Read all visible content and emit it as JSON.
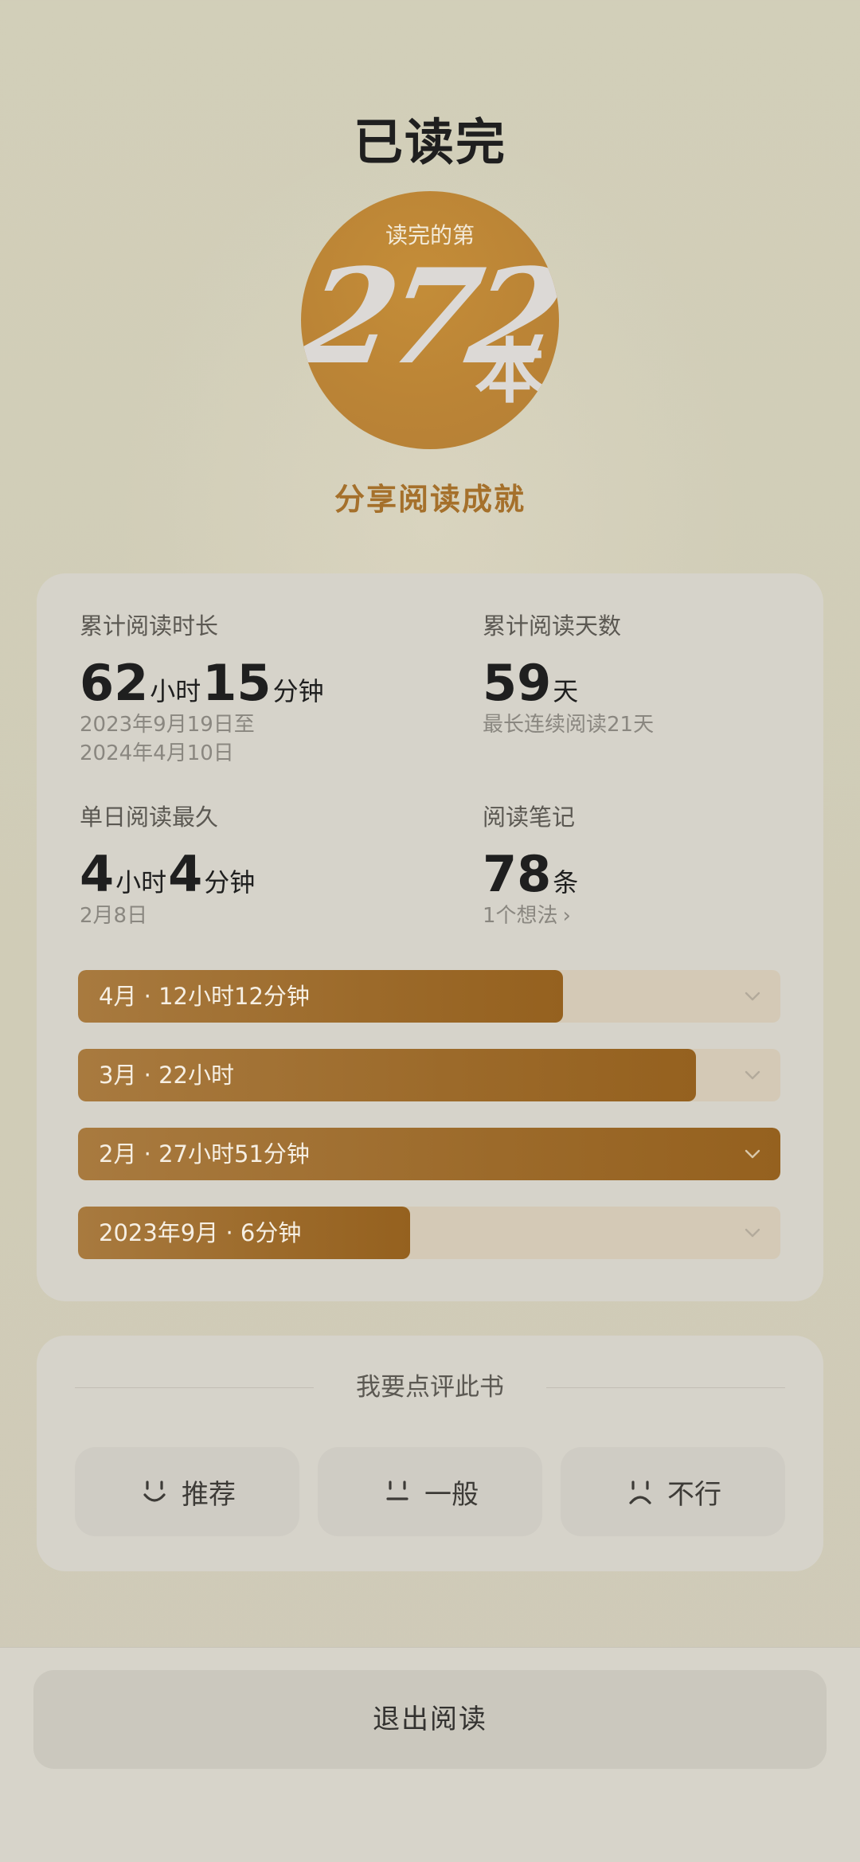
{
  "header": {
    "title": "已读完"
  },
  "badge": {
    "caption": "读完的第",
    "number": "272",
    "unit": "本"
  },
  "share": {
    "label": "分享阅读成就"
  },
  "stats": {
    "total_time": {
      "label": "累计阅读时长",
      "hours": "62",
      "hours_unit": "小时",
      "minutes": "15",
      "minutes_unit": "分钟",
      "range_start": "2023年9月19日至",
      "range_end": "2024年4月10日"
    },
    "total_days": {
      "label": "累计阅读天数",
      "value": "59",
      "unit": "天",
      "sub": "最长连续阅读21天"
    },
    "longest_day": {
      "label": "单日阅读最久",
      "hours": "4",
      "hours_unit": "小时",
      "minutes": "4",
      "minutes_unit": "分钟",
      "date": "2月8日"
    },
    "notes": {
      "label": "阅读笔记",
      "value": "78",
      "unit": "条",
      "sub": "1个想法"
    }
  },
  "monthly": [
    {
      "label": "4月 · 12小时12分钟",
      "fill": 0.69
    },
    {
      "label": "3月 · 22小时",
      "fill": 0.88
    },
    {
      "label": "2月 · 27小时51分钟",
      "fill": 1.0
    },
    {
      "label": "2023年9月 · 6分钟",
      "fill": 0.473
    }
  ],
  "review": {
    "title": "我要点评此书",
    "options": [
      {
        "label": "推荐",
        "icon": "smile-face-icon"
      },
      {
        "label": "一般",
        "icon": "neutral-face-icon"
      },
      {
        "label": "不行",
        "icon": "frown-face-icon"
      }
    ]
  },
  "footer": {
    "exit_label": "退出阅读"
  },
  "colors": {
    "accent": "#a5702b",
    "bar_fill": "#9c6a2a",
    "bar_track": "#d4c9b6"
  }
}
